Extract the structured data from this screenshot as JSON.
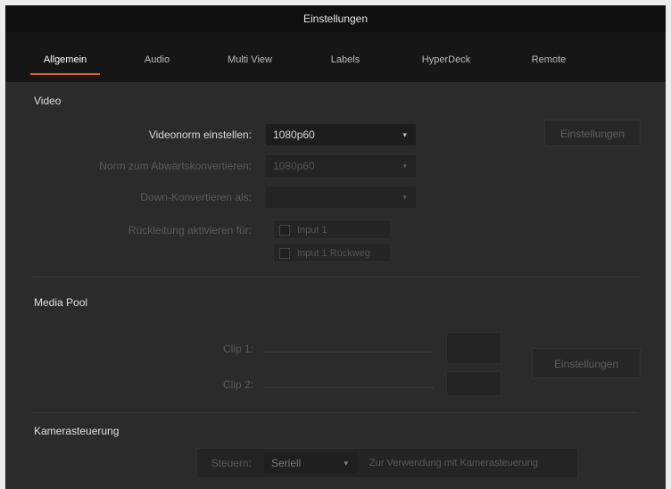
{
  "window": {
    "title": "Einstellungen"
  },
  "tabs": [
    {
      "label": "Allgemein"
    },
    {
      "label": "Audio"
    },
    {
      "label": "Multi View"
    },
    {
      "label": "Labels"
    },
    {
      "label": "HyperDeck"
    },
    {
      "label": "Remote"
    }
  ],
  "video": {
    "section_title": "Video",
    "format_label": "Videonorm einstellen:",
    "format_value": "1080p60",
    "down_label": "Norm zum Abwärtskonvertieren:",
    "down_value": "1080p60",
    "third_label": "Down-Konvertieren als:",
    "third_value": "",
    "settings_button": "Einstellungen",
    "checks_label": "Rückleitung aktivieren für:",
    "check1": "Input 1",
    "check2": "Input 1 Rückweg"
  },
  "media_pool": {
    "section_title": "Media Pool",
    "clip1_label": "Clip 1:",
    "clip2_label": "Clip 2:",
    "settings_button": "Einstellungen"
  },
  "camera": {
    "section_title": "Kamerasteuerung",
    "mode_label": "Steuern:",
    "mode_value": "Seriell",
    "status_text": "Zur Verwendung mit Kamerasteuerung"
  }
}
